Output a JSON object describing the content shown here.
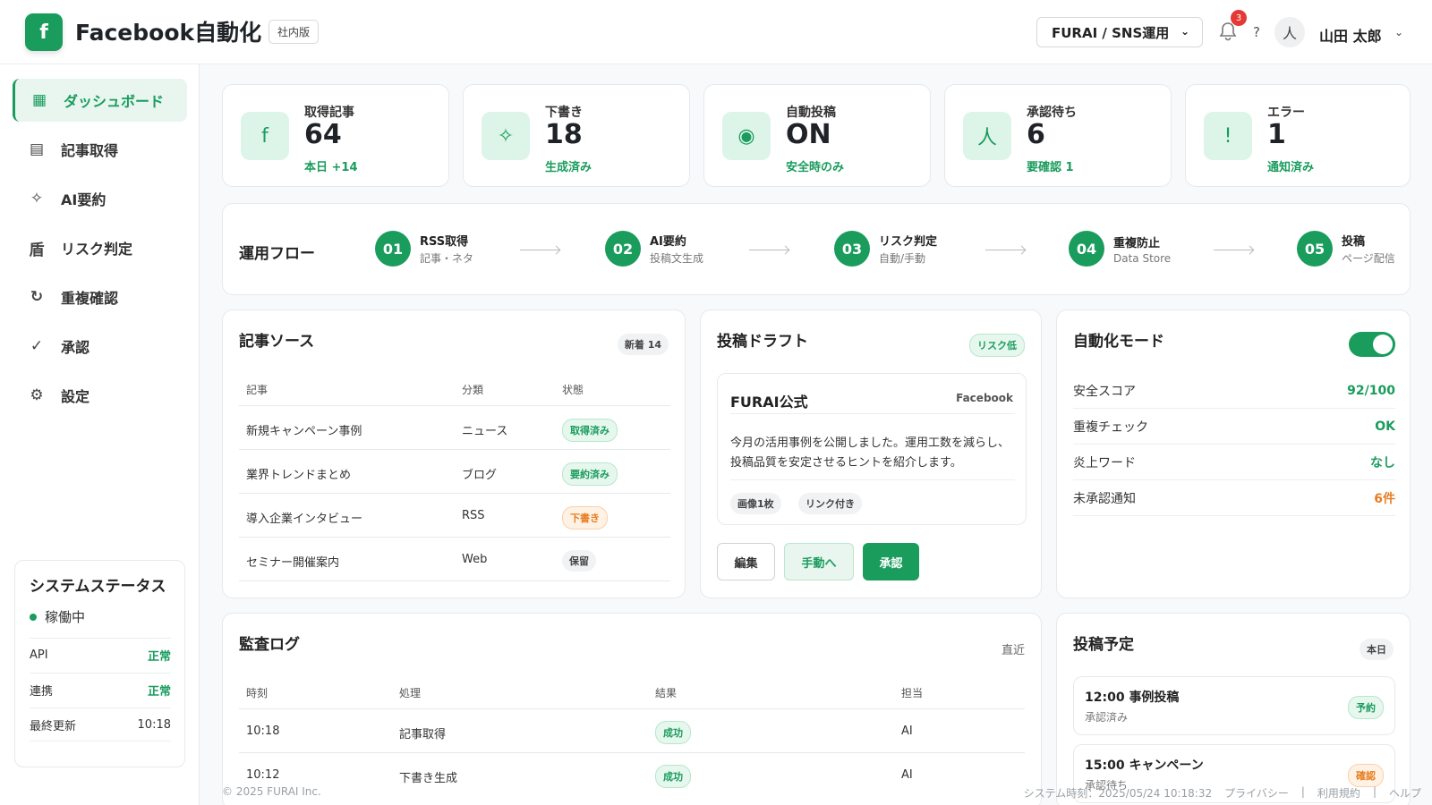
{
  "header": {
    "logo_letter": "f",
    "title": "Facebook自動化",
    "edition": "社内版",
    "workspace": "FURAI / SNS運用",
    "notification_count": "3",
    "help": "?",
    "avatar_glyph": "人",
    "user_name": "山田 太郎"
  },
  "sidebar": {
    "items": [
      {
        "label": "ダッシュボード",
        "icon": "grid-icon",
        "active": true
      },
      {
        "label": "記事取得",
        "icon": "list-icon"
      },
      {
        "label": "AI要約",
        "icon": "sparkle-icon"
      },
      {
        "label": "リスク判定",
        "icon": "shield-icon"
      },
      {
        "label": "重複確認",
        "icon": "refresh-icon"
      },
      {
        "label": "承認",
        "icon": "check-icon"
      },
      {
        "label": "設定",
        "icon": "gear-icon"
      }
    ],
    "system_status": {
      "title": "システムステータス",
      "state": "稼働中",
      "rows": [
        {
          "label": "API",
          "value": "正常"
        },
        {
          "label": "連携",
          "value": "正常"
        },
        {
          "label": "最終更新",
          "value": "10:18"
        }
      ]
    }
  },
  "stats": [
    {
      "label": "取得記事",
      "value": "64",
      "sub": "本日 +14",
      "glyph": "f"
    },
    {
      "label": "下書き",
      "value": "18",
      "sub": "生成済み",
      "glyph": "✧"
    },
    {
      "label": "自動投稿",
      "value": "ON",
      "sub": "安全時のみ",
      "glyph": "◉"
    },
    {
      "label": "承認待ち",
      "value": "6",
      "sub": "要確認 1",
      "glyph": "人"
    },
    {
      "label": "エラー",
      "value": "1",
      "sub": "通知済み",
      "glyph": "!"
    }
  ],
  "flow": {
    "title": "運用フロー",
    "steps": [
      {
        "num": "01",
        "label": "RSS取得",
        "sub": "記事・ネタ"
      },
      {
        "num": "02",
        "label": "AI要約",
        "sub": "投稿文生成"
      },
      {
        "num": "03",
        "label": "リスク判定",
        "sub": "自動/手動"
      },
      {
        "num": "04",
        "label": "重複防止",
        "sub": "Data Store"
      },
      {
        "num": "05",
        "label": "投稿",
        "sub": "ページ配信"
      }
    ]
  },
  "sources": {
    "title": "記事ソース",
    "badge": "新着 14",
    "columns": [
      "記事",
      "分類",
      "状態"
    ],
    "rows": [
      {
        "title": "新規キャンペーン事例",
        "category": "ニュース",
        "status": "取得済み",
        "tone": "green"
      },
      {
        "title": "業界トレンドまとめ",
        "category": "ブログ",
        "status": "要約済み",
        "tone": "green"
      },
      {
        "title": "導入企業インタビュー",
        "category": "RSS",
        "status": "下書き",
        "tone": "orange"
      },
      {
        "title": "セミナー開催案内",
        "category": "Web",
        "status": "保留",
        "tone": "gray"
      }
    ]
  },
  "draft": {
    "title": "投稿ドラフト",
    "risk_badge": "リスク低",
    "page_name": "FURAI公式",
    "platform": "Facebook",
    "body_line1": "今月の活用事例を公開しました。運用工数を減らし、",
    "body_line2": "投稿品質を安定させるヒントを紹介します。",
    "tags": [
      "画像1枚",
      "リンク付き"
    ],
    "buttons": {
      "edit": "編集",
      "manual": "手動へ",
      "approve": "承認"
    }
  },
  "automation": {
    "title": "自動化モード",
    "toggle_on": true,
    "rows": [
      {
        "label": "安全スコア",
        "value": "92/100",
        "tone": "green"
      },
      {
        "label": "重複チェック",
        "value": "OK",
        "tone": "green"
      },
      {
        "label": "炎上ワード",
        "value": "なし",
        "tone": "green"
      },
      {
        "label": "未承認通知",
        "value": "6件",
        "tone": "orange"
      }
    ]
  },
  "audit": {
    "title": "監査ログ",
    "filter": "直近",
    "columns": [
      "時刻",
      "処理",
      "結果",
      "担当"
    ],
    "rows": [
      {
        "time": "10:18",
        "action": "記事取得",
        "result": "成功",
        "owner": "AI"
      },
      {
        "time": "10:12",
        "action": "下書き生成",
        "result": "成功",
        "owner": "AI"
      }
    ]
  },
  "schedule": {
    "title": "投稿予定",
    "badge": "本日",
    "items": [
      {
        "title": "12:00 事例投稿",
        "sub": "承認済み",
        "badge": "予約",
        "tone": "green"
      },
      {
        "title": "15:00 キャンペーン",
        "sub": "承認待ち",
        "badge": "確認",
        "tone": "orange"
      }
    ]
  },
  "footer": {
    "copyright": "© 2025 FURAI Inc.",
    "system_time": "システム時刻：2025/05/24 10:18:32",
    "links": [
      "プライバシー",
      "利用規約",
      "ヘルプ"
    ]
  },
  "colors": {
    "accent": "#1a9c5d",
    "warning": "#e67e22",
    "danger": "#e53935"
  }
}
